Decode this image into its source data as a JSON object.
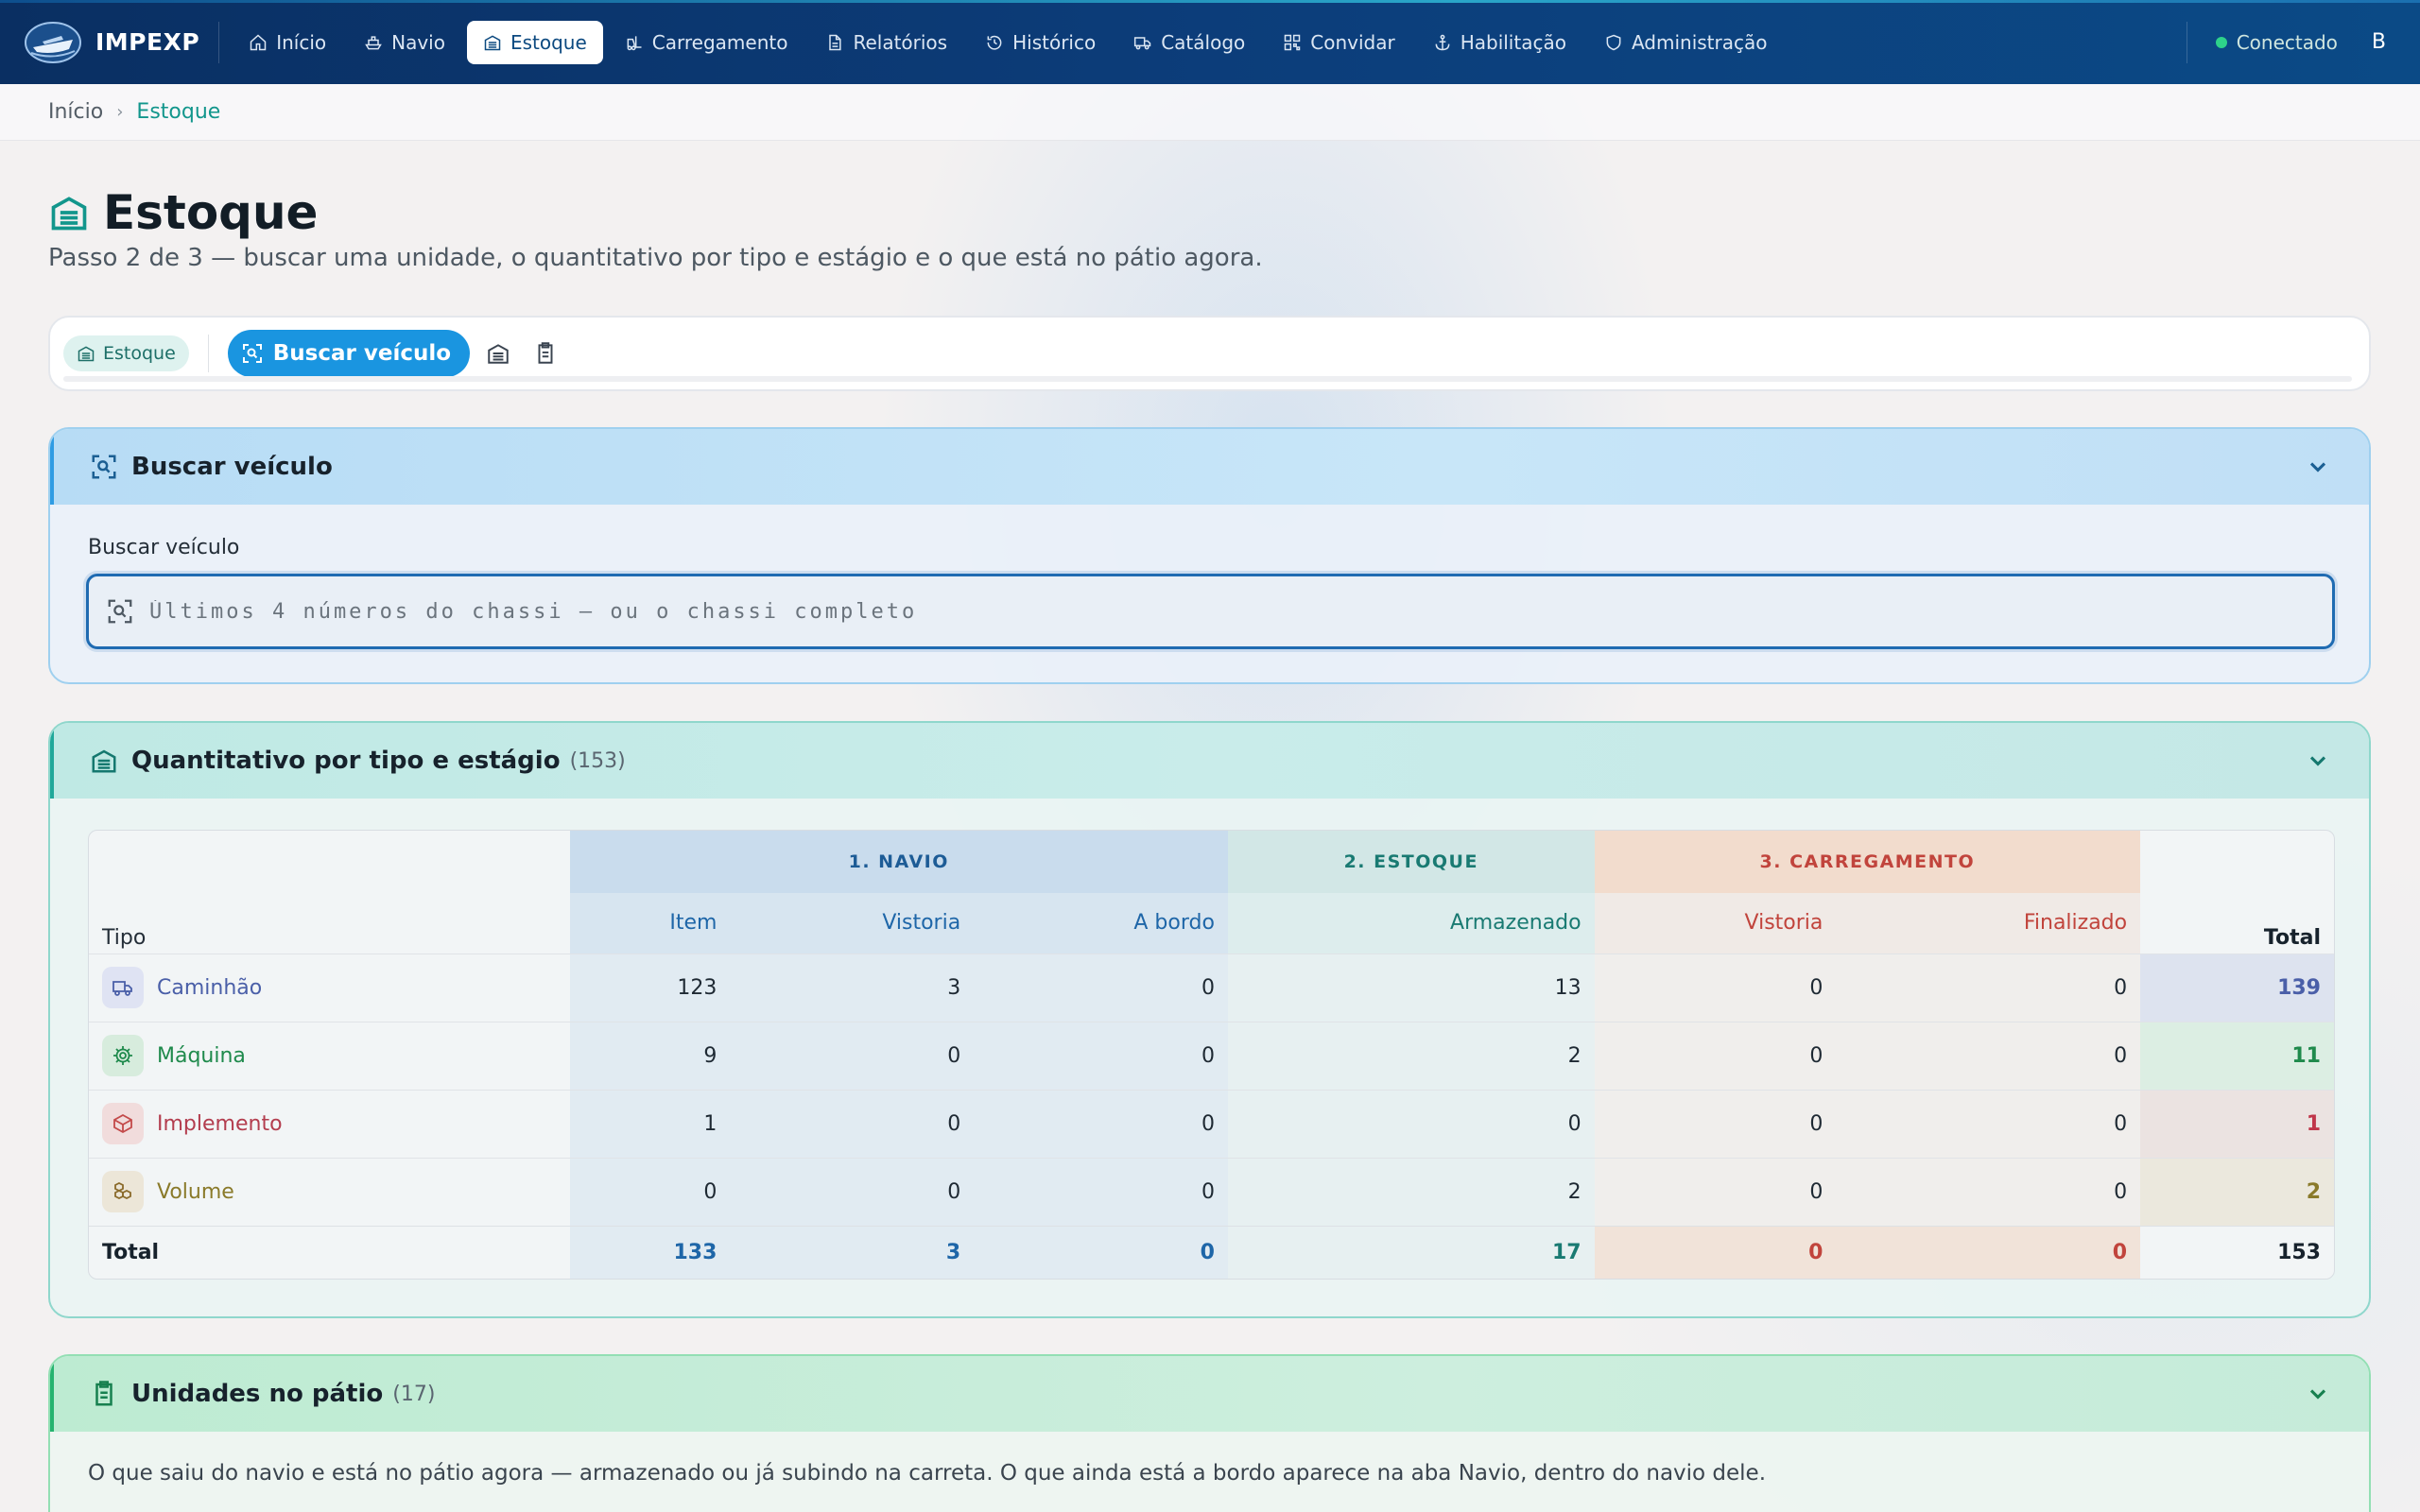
{
  "app": {
    "brand": "IMPEXP"
  },
  "nav": {
    "items": [
      {
        "id": "inicio",
        "label": "Início",
        "icon": "home-icon"
      },
      {
        "id": "navio",
        "label": "Navio",
        "icon": "ship-icon"
      },
      {
        "id": "estoque",
        "label": "Estoque",
        "icon": "warehouse-icon",
        "active": true
      },
      {
        "id": "carregamento",
        "label": "Carregamento",
        "icon": "forklift-icon"
      },
      {
        "id": "relatorios",
        "label": "Relatórios",
        "icon": "file-icon"
      },
      {
        "id": "historico",
        "label": "Histórico",
        "icon": "history-icon"
      },
      {
        "id": "catalogo",
        "label": "Catálogo",
        "icon": "truck-icon"
      },
      {
        "id": "convidar",
        "label": "Convidar",
        "icon": "qr-icon"
      },
      {
        "id": "habilitacao",
        "label": "Habilitação",
        "icon": "anchor-icon"
      },
      {
        "id": "administracao",
        "label": "Administração",
        "icon": "shield-icon"
      }
    ],
    "status": "Conectado",
    "user_initial": "B"
  },
  "breadcrumb": {
    "home": "Início",
    "current": "Estoque"
  },
  "header": {
    "title": "Estoque",
    "subtitle": "Passo 2 de 3 — buscar uma unidade, o quantitativo por tipo e estágio e o que está no pátio agora."
  },
  "toolbar": {
    "chip_label": "Estoque",
    "search_button": "Buscar veículo"
  },
  "search_panel": {
    "title": "Buscar veículo",
    "field_label": "Buscar veículo",
    "placeholder": "Últimos 4 números do chassi — ou o chassi completo"
  },
  "qty_panel": {
    "title": "Quantitativo por tipo e estágio",
    "count": "(153)",
    "groups": {
      "navio": "1. NAVIO",
      "estoque": "2. ESTOQUE",
      "carregamento": "3. CARREGAMENTO"
    },
    "columns": {
      "tipo": "Tipo",
      "item": "Item",
      "vistoria_navio": "Vistoria",
      "a_bordo": "A bordo",
      "armazenado": "Armazenado",
      "vistoria_carr": "Vistoria",
      "finalizado": "Finalizado",
      "total": "Total"
    },
    "rows": [
      {
        "tipo": "Caminhão",
        "item": "123",
        "vistoria_navio": "3",
        "a_bordo": "0",
        "armazenado": "13",
        "vistoria_carr": "0",
        "finalizado": "0",
        "total": "139"
      },
      {
        "tipo": "Máquina",
        "item": "9",
        "vistoria_navio": "0",
        "a_bordo": "0",
        "armazenado": "2",
        "vistoria_carr": "0",
        "finalizado": "0",
        "total": "11"
      },
      {
        "tipo": "Implemento",
        "item": "1",
        "vistoria_navio": "0",
        "a_bordo": "0",
        "armazenado": "0",
        "vistoria_carr": "0",
        "finalizado": "0",
        "total": "1"
      },
      {
        "tipo": "Volume",
        "item": "0",
        "vistoria_navio": "0",
        "a_bordo": "0",
        "armazenado": "2",
        "vistoria_carr": "0",
        "finalizado": "0",
        "total": "2"
      }
    ],
    "totals": {
      "label": "Total",
      "item": "133",
      "vistoria_navio": "3",
      "a_bordo": "0",
      "armazenado": "17",
      "vistoria_carr": "0",
      "finalizado": "0",
      "total": "153"
    }
  },
  "yard_panel": {
    "title": "Unidades no pátio",
    "count": "(17)",
    "description": "O que saiu do navio e está no pátio agora — armazenado ou já subindo na carreta. O que ainda está a bordo aparece na aba Navio, dentro do navio dele."
  },
  "colors": {
    "caminhao": "#4a5fa8",
    "maquina": "#1f8a4c",
    "implemento": "#b33d4e",
    "volume": "#8a7a2a"
  }
}
